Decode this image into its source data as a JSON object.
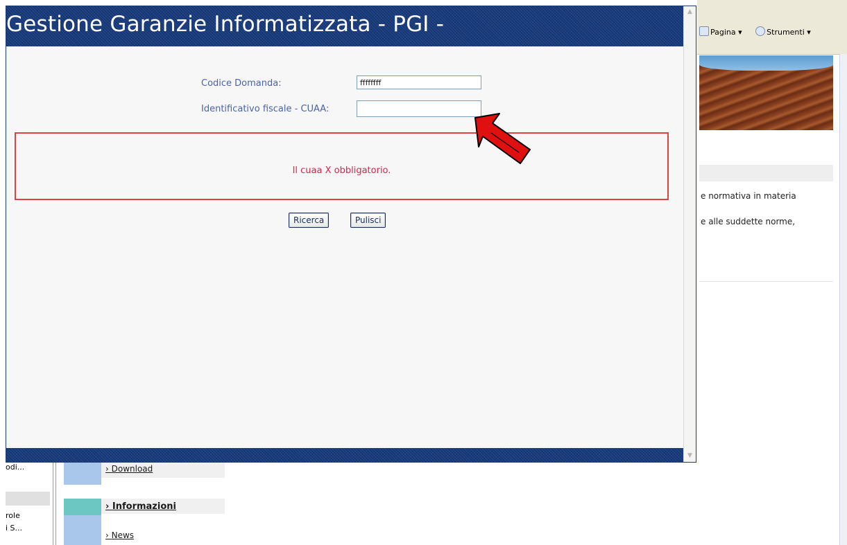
{
  "background_browser": {
    "toolbar": {
      "pagina": "Pagina ▾",
      "strumenti": "Strumenti ▾"
    },
    "text_line_1": "e normativa in materia",
    "text_line_2": "e alle suddette norme,",
    "left_column": {
      "item_1": "odi...",
      "item_2": "role",
      "item_3": "i S..."
    },
    "menu": {
      "download": "Download",
      "informazioni": "Informazioni",
      "news": "News"
    }
  },
  "popup": {
    "title": "Gestione Garanzie Informatizzata - PGI -",
    "form": {
      "codice_domanda_label": "Codice Domanda:",
      "codice_domanda_value": "ffffffff",
      "cuaa_label": "Identificativo fiscale - CUAA:",
      "cuaa_value": ""
    },
    "error_message": "Il cuaa X obbligatorio.",
    "buttons": {
      "ricerca": "Ricerca",
      "pulisci": "Pulisci"
    }
  },
  "annotation": {
    "arrow_color": "#e01010",
    "icon": "red-arrow-icon"
  }
}
